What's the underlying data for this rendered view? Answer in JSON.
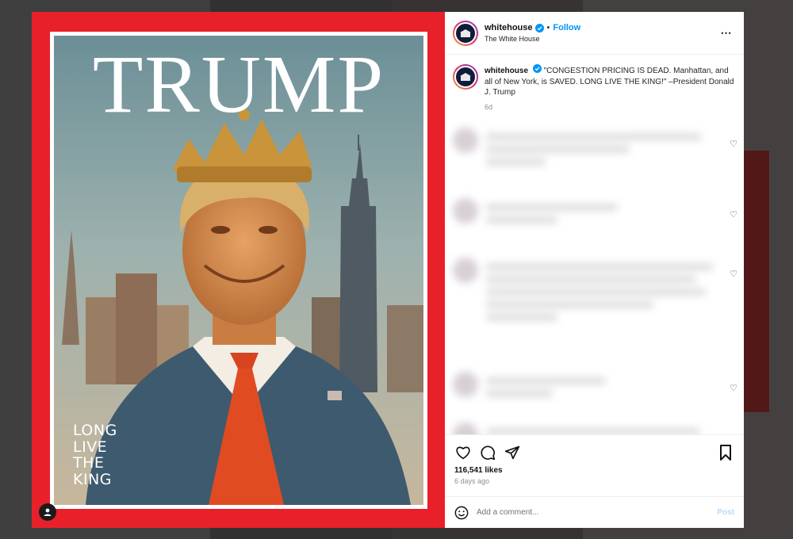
{
  "post": {
    "cover": {
      "masthead": "TRUMP",
      "tagline": [
        "LONG",
        "LIVE",
        "THE",
        "KING"
      ]
    },
    "author": {
      "username": "whitehouse",
      "display_name": "The White House",
      "follow_label": "Follow",
      "separator": "•"
    },
    "caption": {
      "username": "whitehouse",
      "text": "\"CONGESTION PRICING IS DEAD. Manhattan, and all of New York, is SAVED. LONG LIVE THE KING!\" –President Donald J. Trump",
      "time": "6d"
    },
    "more_icon": "⋯",
    "likes": "116,541 likes",
    "posted_ago": "6 days ago",
    "comment_placeholder": "Add a comment...",
    "post_label": "Post"
  },
  "colors": {
    "frame_red": "#e8202a",
    "link_blue": "#0095f6",
    "post_disabled": "#b3dbff"
  },
  "icons": {
    "like": "heart-icon",
    "comment": "comment-icon",
    "share": "share-icon",
    "save": "bookmark-icon",
    "emoji": "emoji-icon",
    "more": "more-icon",
    "user_tag": "user-tag-icon"
  }
}
